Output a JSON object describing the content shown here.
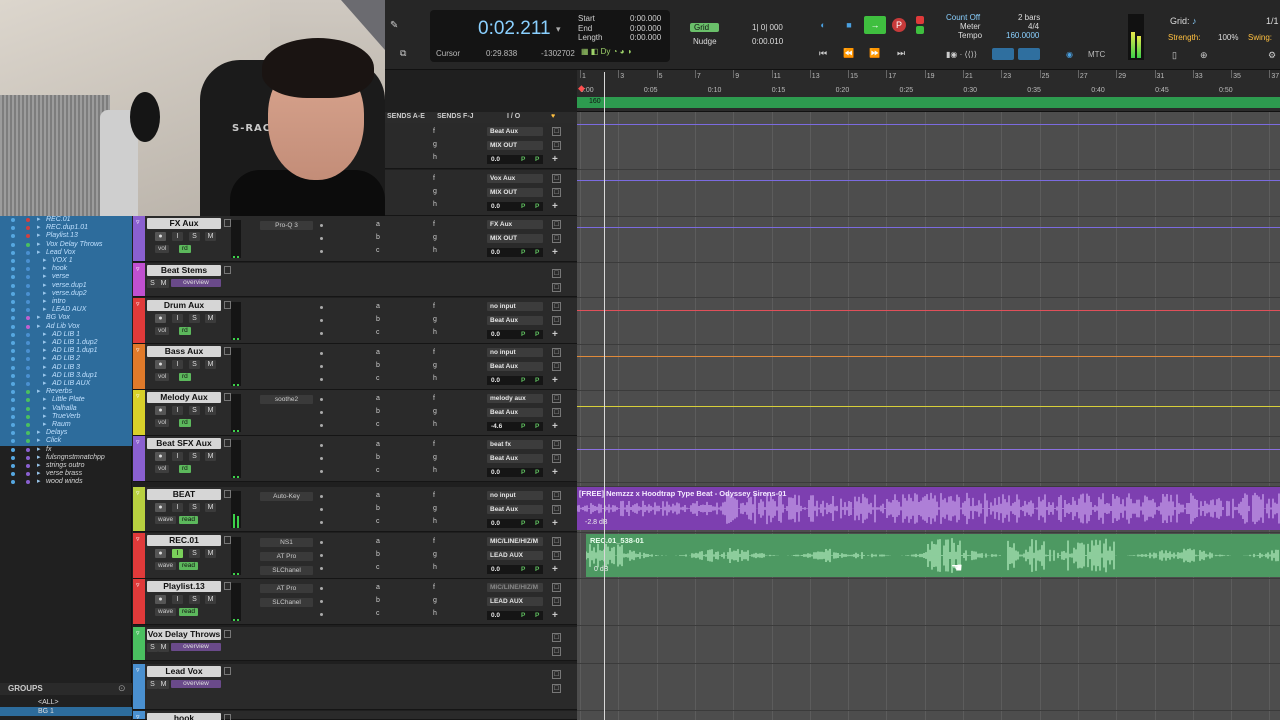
{
  "transport": {
    "main_counter": "0:02.211",
    "start_label": "Start",
    "end_label": "End",
    "length_label": "Length",
    "start_value": "0:00.000",
    "end_value": "0:00.000",
    "length_value": "0:00.000",
    "cursor_label": "Cursor",
    "cursor_value": "0:29.838",
    "sample_value": "-1302702",
    "dyn_label": "Dy",
    "grid_label": "Grid",
    "grid_value": "1| 0| 000",
    "nudge_label": "Nudge",
    "nudge_value": "0:00.010",
    "count_off_label": "Count Off",
    "count_off_value": "2 bars",
    "meter_label": "Meter",
    "meter_value": "4/4",
    "tempo_label": "Tempo",
    "tempo_value": "160.0000",
    "mtc_label": "MTC",
    "grid_right_label": "Grid:",
    "grid_right_value": "1/1",
    "strength_label": "Strength:",
    "strength_value": "100%",
    "swing_label": "Swing:"
  },
  "mix_headers": {
    "sends_ae": "SENDS A-E",
    "sends_fj": "SENDS F-J",
    "io": "I / O"
  },
  "clip_list": {
    "items": [
      {
        "label": "REC.01",
        "indent": 46,
        "color": "#d04040",
        "sel": true
      },
      {
        "label": "REC.dup1.01",
        "indent": 46,
        "color": "#d04040",
        "sel": true
      },
      {
        "label": "Playlist.13",
        "indent": 46,
        "color": "#d04040",
        "sel": true
      },
      {
        "label": "Vox Delay Throws",
        "indent": 46,
        "color": "#4ac060",
        "sel": true
      },
      {
        "label": "Lead Vox",
        "indent": 46,
        "color": "#4a90d0",
        "sel": true
      },
      {
        "label": "VOX 1",
        "indent": 52,
        "color": "#4a90d0",
        "sel": true
      },
      {
        "label": "hook",
        "indent": 52,
        "color": "#4a90d0",
        "sel": true
      },
      {
        "label": "verse",
        "indent": 52,
        "color": "#4a90d0",
        "sel": true
      },
      {
        "label": "verse.dup1",
        "indent": 52,
        "color": "#4a90d0",
        "sel": true
      },
      {
        "label": "verse.dup2",
        "indent": 52,
        "color": "#4a90d0",
        "sel": true
      },
      {
        "label": "intro",
        "indent": 52,
        "color": "#4a90d0",
        "sel": true
      },
      {
        "label": "LEAD AUX",
        "indent": 52,
        "color": "#4a90d0",
        "sel": true
      },
      {
        "label": "BG Vox",
        "indent": 46,
        "color": "#c060d0",
        "sel": true
      },
      {
        "label": "Ad Lib Vox",
        "indent": 46,
        "color": "#c060d0",
        "sel": true
      },
      {
        "label": "AD LIB 1",
        "indent": 52,
        "color": "#4a90d0",
        "sel": true
      },
      {
        "label": "AD LIB 1.dup2",
        "indent": 52,
        "color": "#4a90d0",
        "sel": true
      },
      {
        "label": "AD LIB 1.dup1",
        "indent": 52,
        "color": "#4a90d0",
        "sel": true
      },
      {
        "label": "AD LIB 2",
        "indent": 52,
        "color": "#4a90d0",
        "sel": true
      },
      {
        "label": "AD LIB 3",
        "indent": 52,
        "color": "#4a90d0",
        "sel": true
      },
      {
        "label": "AD LIB 3.dup1",
        "indent": 52,
        "color": "#4a90d0",
        "sel": true
      },
      {
        "label": "AD LIB AUX",
        "indent": 52,
        "color": "#4a90d0",
        "sel": true
      },
      {
        "label": "Reverbs",
        "indent": 46,
        "color": "#4ac060",
        "sel": true
      },
      {
        "label": "Little Plate",
        "indent": 52,
        "color": "#4ac060",
        "sel": true
      },
      {
        "label": "Valhalla",
        "indent": 52,
        "color": "#4ac060",
        "sel": true
      },
      {
        "label": "TrueVerb",
        "indent": 52,
        "color": "#4ac060",
        "sel": true
      },
      {
        "label": "Raum",
        "indent": 52,
        "color": "#4ac060",
        "sel": true
      },
      {
        "label": "Delays",
        "indent": 46,
        "color": "#4ac060",
        "sel": true
      },
      {
        "label": "Click",
        "indent": 46,
        "color": "#4ac060",
        "sel": true
      },
      {
        "label": "fx",
        "indent": 46,
        "color": "#8a60d0",
        "sel": false
      },
      {
        "label": "fulsngnstmnatchpp",
        "indent": 46,
        "color": "#8a60d0",
        "sel": false
      },
      {
        "label": "strings outro",
        "indent": 46,
        "color": "#8a60d0",
        "sel": false
      },
      {
        "label": "verse brass",
        "indent": 46,
        "color": "#8a60d0",
        "sel": false
      },
      {
        "label": "wood winds",
        "indent": 46,
        "color": "#8a60d0",
        "sel": false
      }
    ]
  },
  "groups": {
    "header": "GROUPS",
    "items": [
      "<ALL>",
      "BG 1"
    ]
  },
  "tracks": [
    {
      "name": "",
      "color": "#8a60d0",
      "io_in": "Beat Aux",
      "io_out": "MIX OUT",
      "vol": "0.0",
      "insert": "",
      "top": true
    },
    {
      "name": "",
      "color": "#8a60d0",
      "io_in": "Vox Aux",
      "io_out": "MIX OUT",
      "vol": "0.0",
      "insert": "",
      "top": true
    },
    {
      "name": "FX Aux",
      "color": "#8a60d0",
      "io_in": "FX Aux",
      "io_out": "MIX OUT",
      "vol": "0.0",
      "insert": "Pro-Q 3"
    },
    {
      "name": "Beat Stems",
      "color": "#c050d0",
      "folder": true,
      "overview": "overview"
    },
    {
      "name": "Drum Aux",
      "color": "#e03a3a",
      "io_in": "no input",
      "io_out": "Beat Aux",
      "vol": "0.0",
      "insert": ""
    },
    {
      "name": "Bass Aux",
      "color": "#e07a2a",
      "io_in": "no input",
      "io_out": "Beat Aux",
      "vol": "0.0",
      "insert": ""
    },
    {
      "name": "Melody Aux",
      "color": "#d8d02a",
      "io_in": "melody aux",
      "io_out": "Beat Aux",
      "vol": "-4.6",
      "insert": "soothe2"
    },
    {
      "name": "Beat SFX Aux",
      "color": "#8a60d0",
      "io_in": "beat fx",
      "io_out": "Beat Aux",
      "vol": "0.0",
      "insert": ""
    },
    {
      "name": "BEAT",
      "color": "#b8d040",
      "io_in": "no input",
      "io_out": "Beat Aux",
      "vol": "0.0",
      "insert": "Auto-Key",
      "audio": true
    },
    {
      "name": "REC.01",
      "color": "#e03a3a",
      "io_in": "MIC/LINE/HIZ/M",
      "io_out": "LEAD AUX",
      "vol": "0.0",
      "insert": "NS1",
      "insert2": "AT Pro",
      "insert3": "SLChanel",
      "audio": true
    },
    {
      "name": "Playlist.13",
      "color": "#e03a3a",
      "io_in": "MIC/LINE/HIZ/M",
      "io_out": "LEAD AUX",
      "vol": "0.0",
      "insert": "AT Pro",
      "insert2": "SLChanel",
      "audio": true,
      "dim_in": true
    },
    {
      "name": "Vox Delay Throws",
      "color": "#4ac060",
      "folder": true,
      "overview": "overview"
    },
    {
      "name": "Lead Vox",
      "color": "#4a90d0",
      "folder": true,
      "overview": "overview"
    },
    {
      "name": "hook",
      "color": "#4a90d0",
      "partial": true
    }
  ],
  "timeline": {
    "bars": [
      "1",
      "3",
      "5",
      "7",
      "9",
      "11",
      "13",
      "15",
      "17",
      "19",
      "21",
      "23",
      "25",
      "27",
      "29",
      "31",
      "33",
      "35",
      "37"
    ],
    "timecodes": [
      "0:00",
      "0:05",
      "0:10",
      "0:15",
      "0:20",
      "0:25",
      "0:30",
      "0:35",
      "0:40",
      "0:45",
      "0:50"
    ],
    "tempo_marker": "160",
    "beat_clip_name": "[FREE] Nemzzz x Hoodtrap Type Beat - Odyssey Sirens-01",
    "beat_clip_gain": "-2.8 dB",
    "rec_clip_name": "REC.01_538-01",
    "rec_clip_gain": "0 dB"
  },
  "webcam": {
    "chair_text": "S-RAC"
  },
  "colors": {
    "accent_blue": "#8ad0ff",
    "grid_green": "#6ac06a",
    "beat_clip": "#7d3fb0",
    "rec_clip": "#4d9962",
    "tempo_lane": "#2d9b4f"
  }
}
